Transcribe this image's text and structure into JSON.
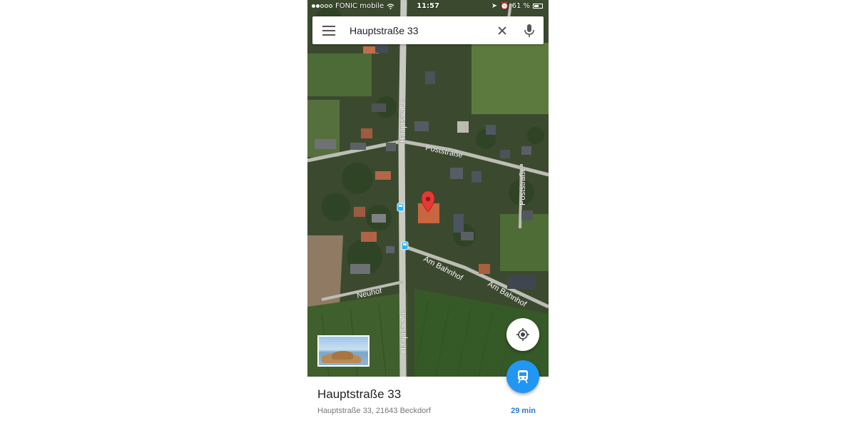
{
  "status_bar": {
    "carrier": "FONIC mobile",
    "time": "11:57",
    "battery": "61 %",
    "battery_level": 0.61
  },
  "search": {
    "query": "Hauptstraße 33",
    "menu_icon": "hamburger-menu-icon",
    "clear_icon": "close-icon",
    "mic_icon": "microphone-icon"
  },
  "map": {
    "street_labels": {
      "hauptstrasse_north": "Hauptstraße",
      "hauptstrasse_south": "Hauptstraße",
      "poststrasse_west": "Poststraße",
      "poststrasse_east": "Poststraße",
      "am_bahnhof_west": "Am Bahnhof",
      "am_bahnhof_east": "Am Bahnhof",
      "neuhof": "Neuhof"
    },
    "pin_color": "#e53935",
    "transit_stop_color": "#29b6f6"
  },
  "buttons": {
    "my_location_icon": "my-location-icon",
    "transit_icon": "train-icon",
    "transit_color": "#2196f3"
  },
  "place": {
    "title": "Hauptstraße 33",
    "address": "Hauptstraße 33, 21643 Beckdorf",
    "travel_time": "29 min"
  }
}
